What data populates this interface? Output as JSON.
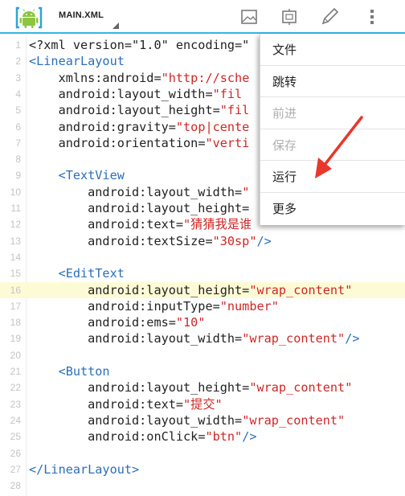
{
  "toolbar": {
    "file_name": "MAIN.XML",
    "icons": [
      "android-app-icon",
      "image-icon",
      "layout-icon",
      "pencil-icon",
      "overflow-menu-icon"
    ]
  },
  "colors": {
    "accent": "#33b5e5",
    "tag": "#2a6fb8",
    "string": "#d02626",
    "highlight_line": "#fdfbd6",
    "arrow": "#e8372c"
  },
  "editor": {
    "line_numbers": [
      "1",
      "2",
      "3",
      "4",
      "5",
      "6",
      "7",
      "8",
      "9",
      "10",
      "11",
      "12",
      "13",
      "14",
      "15",
      "16",
      "17",
      "18",
      "19",
      "20",
      "21",
      "22",
      "23",
      "24",
      "25",
      "26",
      "27",
      "28"
    ],
    "highlighted_line": 16,
    "lines": [
      [
        {
          "t": "<?xml version=\"1.0\" encoding=\"",
          "c": "plain"
        }
      ],
      [
        {
          "t": "<LinearLayout",
          "c": "tag"
        }
      ],
      [
        {
          "t": "    xmlns:android",
          "c": "attr"
        },
        {
          "t": "=",
          "c": "punc"
        },
        {
          "t": "\"http://sche",
          "c": "str"
        }
      ],
      [
        {
          "t": "    android:layout_width",
          "c": "attr"
        },
        {
          "t": "=",
          "c": "punc"
        },
        {
          "t": "\"fil",
          "c": "str"
        }
      ],
      [
        {
          "t": "    android:layout_height",
          "c": "attr"
        },
        {
          "t": "=",
          "c": "punc"
        },
        {
          "t": "\"fil",
          "c": "str"
        }
      ],
      [
        {
          "t": "    android:gravity",
          "c": "attr"
        },
        {
          "t": "=",
          "c": "punc"
        },
        {
          "t": "\"top|cente",
          "c": "str"
        }
      ],
      [
        {
          "t": "    android:orientation",
          "c": "attr"
        },
        {
          "t": "=",
          "c": "punc"
        },
        {
          "t": "\"verti",
          "c": "str"
        }
      ],
      [],
      [
        {
          "t": "    <TextView",
          "c": "tag"
        }
      ],
      [
        {
          "t": "        android:layout_width",
          "c": "attr"
        },
        {
          "t": "=",
          "c": "punc"
        },
        {
          "t": "\"",
          "c": "str"
        }
      ],
      [
        {
          "t": "        android:layout_height",
          "c": "attr"
        },
        {
          "t": "=",
          "c": "punc"
        }
      ],
      [
        {
          "t": "        android:text",
          "c": "attr"
        },
        {
          "t": "=",
          "c": "punc"
        },
        {
          "t": "\"猜猜我是谁",
          "c": "str"
        }
      ],
      [
        {
          "t": "        android:textSize",
          "c": "attr"
        },
        {
          "t": "=",
          "c": "punc"
        },
        {
          "t": "\"30sp\"",
          "c": "str"
        },
        {
          "t": "/>",
          "c": "tag"
        }
      ],
      [],
      [
        {
          "t": "    <EditText",
          "c": "tag"
        }
      ],
      [
        {
          "t": "        android:layout_height",
          "c": "attr"
        },
        {
          "t": "=",
          "c": "punc"
        },
        {
          "t": "\"wrap_content\"",
          "c": "str"
        }
      ],
      [
        {
          "t": "        android:inputType",
          "c": "attr"
        },
        {
          "t": "=",
          "c": "punc"
        },
        {
          "t": "\"number\"",
          "c": "str"
        }
      ],
      [
        {
          "t": "        android:ems",
          "c": "attr"
        },
        {
          "t": "=",
          "c": "punc"
        },
        {
          "t": "\"10\"",
          "c": "str"
        }
      ],
      [
        {
          "t": "        android:layout_width",
          "c": "attr"
        },
        {
          "t": "=",
          "c": "punc"
        },
        {
          "t": "\"wrap_content\"",
          "c": "str"
        },
        {
          "t": "/>",
          "c": "tag"
        }
      ],
      [],
      [
        {
          "t": "    <Button",
          "c": "tag"
        }
      ],
      [
        {
          "t": "        android:layout_height",
          "c": "attr"
        },
        {
          "t": "=",
          "c": "punc"
        },
        {
          "t": "\"wrap_content\"",
          "c": "str"
        }
      ],
      [
        {
          "t": "        android:text",
          "c": "attr"
        },
        {
          "t": "=",
          "c": "punc"
        },
        {
          "t": "\"提交\"",
          "c": "str"
        }
      ],
      [
        {
          "t": "        android:layout_width",
          "c": "attr"
        },
        {
          "t": "=",
          "c": "punc"
        },
        {
          "t": "\"wrap_content\"",
          "c": "str"
        }
      ],
      [
        {
          "t": "        android:onClick",
          "c": "attr"
        },
        {
          "t": "=",
          "c": "punc"
        },
        {
          "t": "\"btn\"",
          "c": "str"
        },
        {
          "t": "/>",
          "c": "tag"
        }
      ],
      [],
      [
        {
          "t": "</LinearLayout>",
          "c": "tag"
        }
      ],
      []
    ]
  },
  "menu": {
    "items": [
      {
        "label": "文件",
        "enabled": true
      },
      {
        "label": "跳转",
        "enabled": true
      },
      {
        "label": "前进",
        "enabled": false
      },
      {
        "label": "保存",
        "enabled": false
      },
      {
        "label": "运行",
        "enabled": true
      },
      {
        "label": "更多",
        "enabled": true
      }
    ]
  }
}
